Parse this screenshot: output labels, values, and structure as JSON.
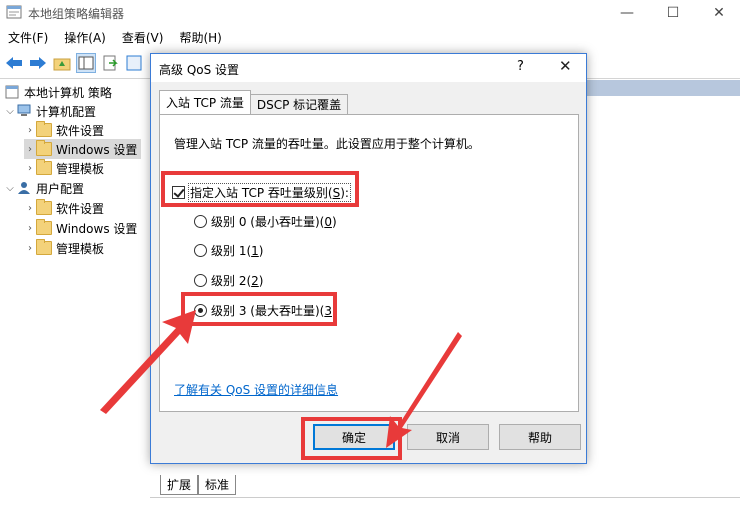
{
  "window": {
    "title": "本地组策略编辑器",
    "minimize": "—",
    "maximize": "☐",
    "close": "✕"
  },
  "menu": [
    "文件(F)",
    "操作(A)",
    "查看(V)",
    "帮助(H)"
  ],
  "tree": {
    "root": "本地计算机 策略",
    "computer_config": "计算机配置",
    "computer_children": [
      "软件设置",
      "Windows 设置",
      "管理模板"
    ],
    "user_config": "用户配置",
    "user_children": [
      "软件设置",
      "Windows 设置",
      "管理模板"
    ]
  },
  "bottom_tabs": [
    "扩展",
    "标准"
  ],
  "dialog": {
    "title": "高级 QoS 设置",
    "help": "?",
    "close": "✕",
    "tabs": [
      "入站 TCP 流量",
      "DSCP 标记覆盖"
    ],
    "description": "管理入站 TCP 流量的吞吐量。此设置应用于整个计算机。",
    "checkbox": {
      "label": "指定入站 TCP 吞吐量级别",
      "hotkey": "S",
      "checked": true
    },
    "radios": [
      {
        "label": "级别 0 (最小吞吐量)",
        "hotkey": "0",
        "checked": false
      },
      {
        "label": "级别 1",
        "hotkey": "1",
        "checked": false
      },
      {
        "label": "级别 2",
        "hotkey": "2",
        "checked": false
      },
      {
        "label": "级别 3 (最大吞吐量)",
        "hotkey": "3",
        "checked": true
      }
    ],
    "link": "了解有关 QoS 设置的详细信息",
    "buttons": {
      "ok": "确定",
      "cancel": "取消",
      "help": "帮助"
    }
  },
  "colors": {
    "annotation": "#e83a3a",
    "accent": "#0078d7",
    "link": "#0066cc"
  }
}
